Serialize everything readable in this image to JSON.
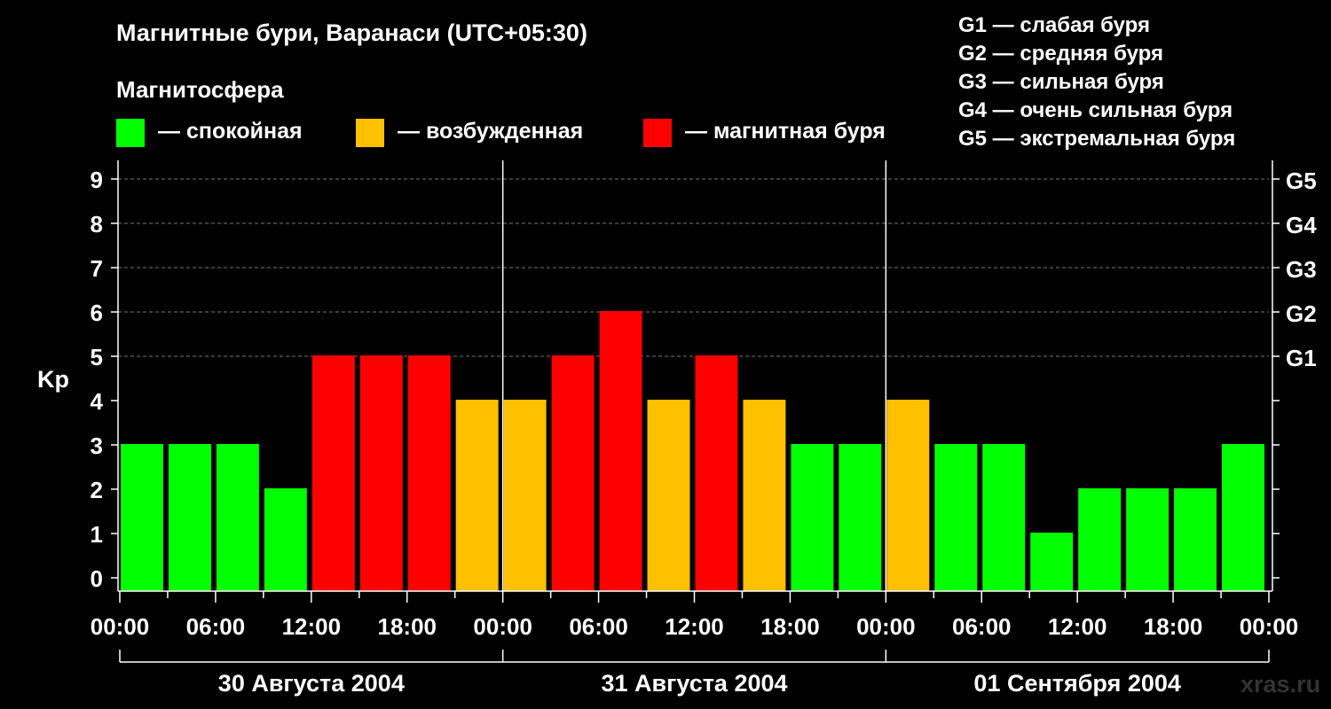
{
  "title": "Магнитные бури, Варанаси (UTC+05:30)",
  "subtitle": "Магнитосфера",
  "legend": [
    {
      "label": "— спокойная",
      "color": "#00ff00"
    },
    {
      "label": "— возбужденная",
      "color": "#ffc000"
    },
    {
      "label": "— магнитная буря",
      "color": "#ff0000"
    }
  ],
  "storm_levels": [
    "G1 — слабая буря",
    "G2 — средняя буря",
    "G3 — сильная буря",
    "G4 — очень сильная буря",
    "G5 — экстремальная буря"
  ],
  "watermark": "xras.ru",
  "chart_data": {
    "type": "bar",
    "ylabel": "Kp",
    "ylim": [
      0,
      9
    ],
    "yticks": [
      0,
      1,
      2,
      3,
      4,
      5,
      6,
      7,
      8,
      9
    ],
    "right_ticks": [
      {
        "value": 5,
        "label": "G1"
      },
      {
        "value": 6,
        "label": "G2"
      },
      {
        "value": 7,
        "label": "G3"
      },
      {
        "value": 8,
        "label": "G4"
      },
      {
        "value": 9,
        "label": "G5"
      }
    ],
    "xtick_labels": [
      "00:00",
      "06:00",
      "12:00",
      "18:00",
      "00:00",
      "06:00",
      "12:00",
      "18:00",
      "00:00",
      "06:00",
      "12:00",
      "18:00",
      "00:00"
    ],
    "dates": [
      "30 Августа 2004",
      "31 Августа 2004",
      "01 Сентября 2004"
    ],
    "grid": "horizontal dashed at 5-9",
    "categories": [
      "30.08 00:00",
      "30.08 03:00",
      "30.08 06:00",
      "30.08 09:00",
      "30.08 12:00",
      "30.08 15:00",
      "30.08 18:00",
      "30.08 21:00",
      "31.08 00:00",
      "31.08 03:00",
      "31.08 06:00",
      "31.08 09:00",
      "31.08 12:00",
      "31.08 15:00",
      "31.08 18:00",
      "31.08 21:00",
      "01.09 00:00",
      "01.09 03:00",
      "01.09 06:00",
      "01.09 09:00",
      "01.09 12:00",
      "01.09 15:00",
      "01.09 18:00",
      "01.09 21:00"
    ],
    "values": [
      3,
      3,
      3,
      2,
      5,
      5,
      5,
      4,
      4,
      5,
      6,
      4,
      5,
      4,
      3,
      3,
      4,
      3,
      3,
      1,
      2,
      2,
      2,
      3
    ],
    "colors": {
      "quiet": "#00ff00",
      "active": "#ffc000",
      "storm": "#ff0000"
    }
  }
}
